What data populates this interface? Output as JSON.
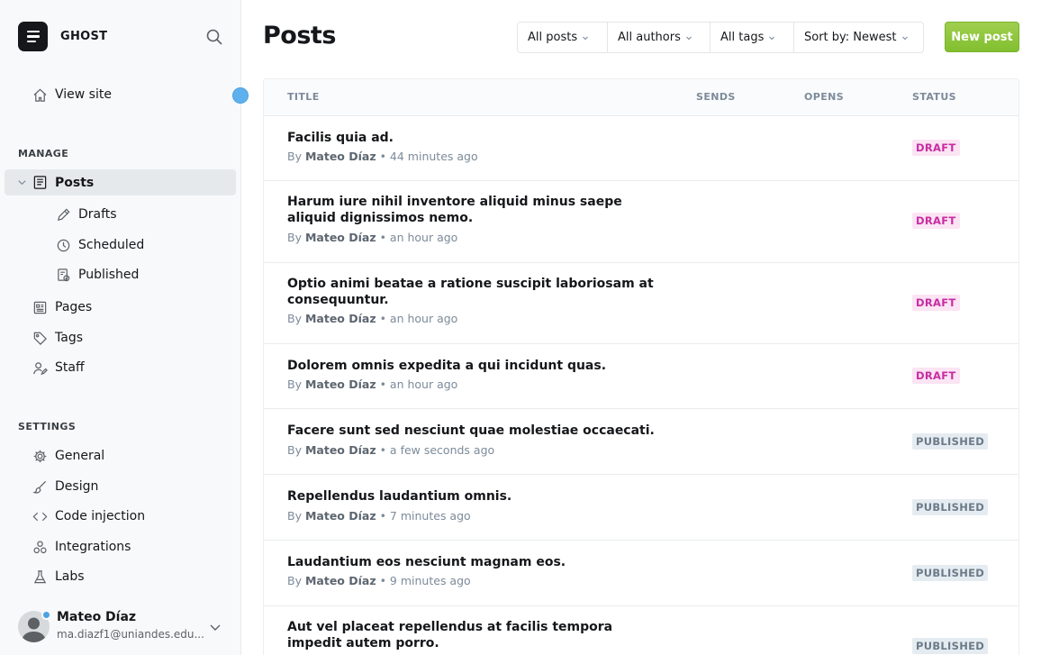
{
  "brand": {
    "name": "GHOST"
  },
  "sidebar": {
    "view_site": "View site",
    "manage_label": "MANAGE",
    "posts": "Posts",
    "drafts": "Drafts",
    "scheduled": "Scheduled",
    "published": "Published",
    "pages": "Pages",
    "tags": "Tags",
    "staff": "Staff",
    "settings_label": "SETTINGS",
    "general": "General",
    "design": "Design",
    "code_injection": "Code injection",
    "integrations": "Integrations",
    "labs": "Labs"
  },
  "user": {
    "name": "Mateo Díaz",
    "email": "ma.diazf1@uniandes.edu..."
  },
  "main": {
    "title": "Posts",
    "filters": {
      "type": "All posts",
      "authors": "All authors",
      "tags": "All tags",
      "sort": "Sort by: Newest"
    },
    "new_post": "New post"
  },
  "table": {
    "headers": {
      "title": "TITLE",
      "sends": "SENDS",
      "opens": "OPENS",
      "status": "STATUS"
    },
    "rows": [
      {
        "title": "Facilis quia ad.",
        "by": "By",
        "author": "Mateo Díaz",
        "time": " • 44 minutes ago",
        "status": "DRAFT"
      },
      {
        "title": "Harum iure nihil inventore aliquid minus saepe aliquid dignissimos nemo.",
        "by": "By",
        "author": "Mateo Díaz",
        "time": " • an hour ago",
        "status": "DRAFT"
      },
      {
        "title": "Optio animi beatae a ratione suscipit laboriosam at consequuntur.",
        "by": "By",
        "author": "Mateo Díaz",
        "time": " • an hour ago",
        "status": "DRAFT"
      },
      {
        "title": "Dolorem omnis expedita a qui incidunt quas.",
        "by": "By",
        "author": "Mateo Díaz",
        "time": " • an hour ago",
        "status": "DRAFT"
      },
      {
        "title": "Facere sunt sed nesciunt quae molestiae occaecati.",
        "by": "By",
        "author": "Mateo Díaz",
        "time": " • a few seconds ago",
        "status": "PUBLISHED"
      },
      {
        "title": "Repellendus laudantium omnis.",
        "by": "By",
        "author": "Mateo Díaz",
        "time": " • 7 minutes ago",
        "status": "PUBLISHED"
      },
      {
        "title": "Laudantium eos nesciunt magnam eos.",
        "by": "By",
        "author": "Mateo Díaz",
        "time": " • 9 minutes ago",
        "status": "PUBLISHED"
      },
      {
        "title": "Aut vel placeat repellendus at facilis tempora impedit autem porro.",
        "status": "PUBLISHED"
      }
    ]
  },
  "colors": {
    "accent_green": "#8dc63f",
    "draft_badge": "#c72ca2",
    "published_badge": "#6c7b88",
    "notification_blue": "#5fb1ee"
  }
}
